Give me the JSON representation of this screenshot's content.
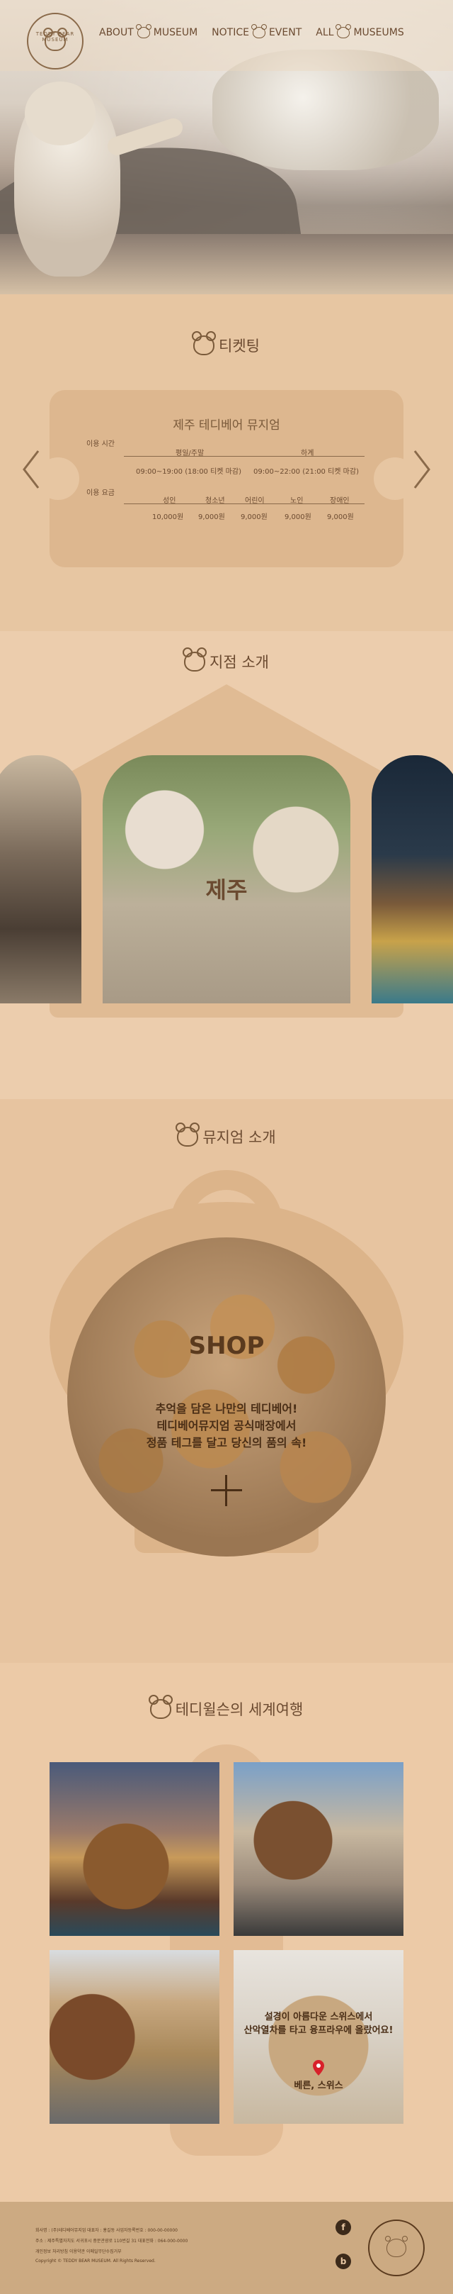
{
  "brand": {
    "logo_text": "TEDDY BEAR MUSEUM"
  },
  "nav": {
    "items": [
      {
        "left": "ABOUT",
        "right": "MUSEUM"
      },
      {
        "left": "NOTICE",
        "right": "EVENT"
      },
      {
        "left": "ALL",
        "right": "MUSEUMS"
      }
    ]
  },
  "ticket": {
    "section_title": "티켓팅",
    "museum_name": "제주 테디베어 뮤지엄",
    "hours_label": "이용 시간",
    "fee_label": "이용 요금",
    "col_weekday": "평일/주말",
    "col_summer": "하계",
    "hours_weekday": "09:00~19:00 (18:00 티켓 마감)",
    "hours_summer": "09:00~22:00 (21:00 티켓 마감)",
    "fee_headers": [
      "성인",
      "청소년",
      "어린이",
      "노인",
      "장애인"
    ],
    "fee_values": [
      "10,000원",
      "9,000원",
      "9,000원",
      "9,000원",
      "9,000원"
    ]
  },
  "branch": {
    "section_title": "지점 소개",
    "current": "제주"
  },
  "museum": {
    "section_title": "뮤지엄 소개",
    "shop_title": "SHOP",
    "shop_desc_1": "추억을 담은 나만의 테디베어!",
    "shop_desc_2": "테디베어뮤지엄 공식매장에서",
    "shop_desc_3": "정품 테그를 달고 당신의 품의 속!"
  },
  "travel": {
    "section_title": "테디윌슨의 세계여행",
    "caption_1": "설경이 아름다운 스위스에서",
    "caption_2": "산악열차를 타고 융프라우에 올랐어요!",
    "location": "베른, 스위스"
  },
  "footer": {
    "row1": "회사명 : (주)테디베어뮤지엄   대표자 : 홍길동   사업자등록번호 : 000-00-00000",
    "row2": "주소 : 제주특별자치도 서귀포시 중문관광로 110번길 31   대표전화 : 064-000-0000",
    "row3": "개인정보 처리방침   이용약관   이메일무단수집거부",
    "row4": "Copyright © TEDDY BEAR MUSEUM. All Rights Reserved.",
    "facebook": "f",
    "blog": "b"
  }
}
